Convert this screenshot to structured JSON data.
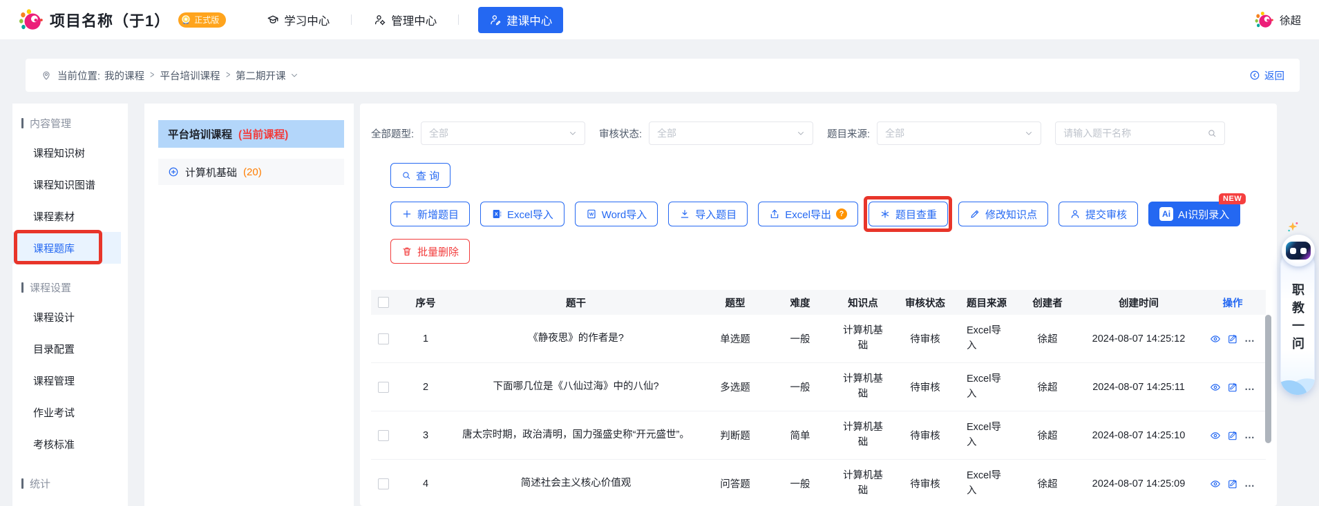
{
  "colors": {
    "primary_blue": "#2468f2",
    "danger_red": "#f23c3c",
    "annotation_red": "#e8352a",
    "version_badge_orange": "#ffa41d",
    "count_orange": "#ff7d00",
    "current_course_bg": "#b3d6fa",
    "active_item_bg": "#e9f3fe",
    "new_badge_red": "#f53f3f"
  },
  "header": {
    "project_title": "项目名称（于1）",
    "version_badge": "正式版",
    "nav_items": [
      {
        "label": "学习中心",
        "icon": "graduate"
      },
      {
        "label": "管理中心",
        "icon": "admin"
      },
      {
        "label": "建课中心",
        "icon": "builder",
        "active": true
      }
    ],
    "user_name": "徐超"
  },
  "breadcrumb": {
    "prefix": "当前位置:",
    "items": [
      {
        "label": "我的课程"
      },
      {
        "label": "平台培训课程"
      },
      {
        "label": "第二期开课"
      }
    ],
    "back_label": "返回"
  },
  "sidebar": {
    "entries": [
      {
        "label": "内容管理",
        "variant": "section",
        "non_interactable": true
      },
      {
        "label": "课程知识树",
        "variant": "item"
      },
      {
        "label": "课程知识图谱",
        "variant": "item"
      },
      {
        "label": "课程素材",
        "variant": "item"
      },
      {
        "label": "课程题库",
        "variant": "item",
        "active": true,
        "annotated": true
      },
      {
        "label": "课程设置",
        "variant": "section",
        "non_interactable": true
      },
      {
        "label": "课程设计",
        "variant": "item"
      },
      {
        "label": "目录配置",
        "variant": "item"
      },
      {
        "label": "课程管理",
        "variant": "item"
      },
      {
        "label": "作业考试",
        "variant": "item"
      },
      {
        "label": "考核标准",
        "variant": "item"
      },
      {
        "label": "统计",
        "variant": "section",
        "non_interactable": true
      }
    ]
  },
  "course_panel": {
    "current_name": "平台培训课程",
    "current_tag": "(当前课程)",
    "chapter_name": "计算机基础",
    "chapter_count": "(20)"
  },
  "filters": {
    "type_label": "全部题型:",
    "status_label": "审核状态:",
    "source_label": "题目来源:",
    "type_value": "全部",
    "status_value": "全部",
    "source_value": "全部",
    "search_placeholder": "请输入题干名称",
    "query_label": "查 询"
  },
  "toolbar": {
    "buttons": [
      {
        "label": "新增题目",
        "icon": "plus"
      },
      {
        "label": "Excel导入",
        "icon": "excel"
      },
      {
        "label": "Word导入",
        "icon": "word"
      },
      {
        "label": "导入题目",
        "icon": "download"
      },
      {
        "label": "Excel导出",
        "icon": "upload",
        "help": "?"
      },
      {
        "label": "题目查重",
        "icon": "dedupe",
        "annotated": true
      },
      {
        "label": "修改知识点",
        "icon": "pencil"
      },
      {
        "label": "提交审核",
        "icon": "person"
      },
      {
        "label": "AI识别录入",
        "icon": "ai",
        "icon_text": "Ai",
        "variant": "primary",
        "badge": "NEW"
      }
    ],
    "delete_label": "批量删除"
  },
  "table": {
    "columns": [
      {
        "label": "序号",
        "cls": "col-no"
      },
      {
        "label": "题干",
        "cls": "col-stem"
      },
      {
        "label": "题型",
        "cls": "col-type"
      },
      {
        "label": "难度",
        "cls": "col-diff"
      },
      {
        "label": "知识点",
        "cls": "col-know"
      },
      {
        "label": "审核状态",
        "cls": "col-status"
      },
      {
        "label": "题目来源",
        "cls": "col-source"
      },
      {
        "label": "创建者",
        "cls": "col-creator"
      },
      {
        "label": "创建时间",
        "cls": "col-time"
      },
      {
        "label": "操作",
        "cls": "col-op"
      }
    ],
    "rows": [
      {
        "no": "1",
        "stem": "《静夜思》的作者是?",
        "type": "单选题",
        "difficulty": "一般",
        "knowledge": "计算机基础",
        "status": "待审核",
        "source": "Excel导入",
        "creator": "徐超",
        "created_at": "2024-08-07 14:25:12"
      },
      {
        "no": "2",
        "stem": "下面哪几位是《八仙过海》中的八仙?",
        "type": "多选题",
        "difficulty": "一般",
        "knowledge": "计算机基础",
        "status": "待审核",
        "source": "Excel导入",
        "creator": "徐超",
        "created_at": "2024-08-07 14:25:11"
      },
      {
        "no": "3",
        "stem": "唐太宗时期，政治清明，国力强盛史称“开元盛世”。",
        "type": "判断题",
        "difficulty": "简单",
        "knowledge": "计算机基础",
        "status": "待审核",
        "source": "Excel导入",
        "creator": "徐超",
        "created_at": "2024-08-07 14:25:10"
      },
      {
        "no": "4",
        "stem": "简述社会主义核心价值观",
        "type": "问答题",
        "difficulty": "一般",
        "knowledge": "计算机基础",
        "status": "待审核",
        "source": "Excel导入",
        "creator": "徐超",
        "created_at": "2024-08-07 14:25:09"
      }
    ],
    "more_label": "…"
  },
  "assistant": {
    "label": "职教一问"
  }
}
